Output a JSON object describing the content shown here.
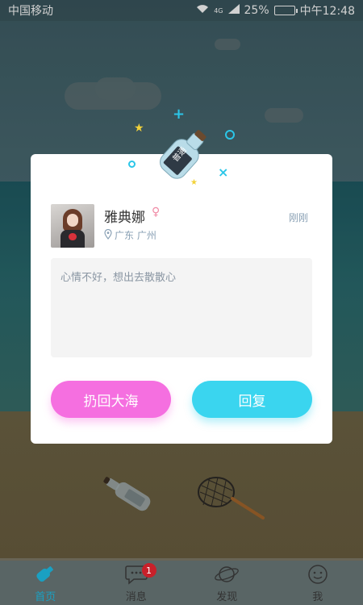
{
  "status_bar": {
    "carrier": "中国移动",
    "network": "4G",
    "battery": "25%",
    "time": "中午12:48"
  },
  "card": {
    "user_name": "雅典娜",
    "gender_icon": "female-icon",
    "time_ago": "刚刚",
    "location": "广东 广州",
    "message": "心情不好，想出去散散心",
    "bottle_label": "普通",
    "throw_back_label": "扔回大海",
    "reply_label": "回复"
  },
  "nav": {
    "items": [
      {
        "label": "首页",
        "icon": "bottle-icon",
        "active": true
      },
      {
        "label": "消息",
        "icon": "chat-bubble-icon",
        "badge": "1"
      },
      {
        "label": "发现",
        "icon": "planet-icon"
      },
      {
        "label": "我",
        "icon": "smiley-icon"
      }
    ]
  },
  "colors": {
    "throw_back": "#f56fe0",
    "reply": "#3ad5ef",
    "active_tab": "#1aa0c2",
    "badge": "#c8202a"
  }
}
